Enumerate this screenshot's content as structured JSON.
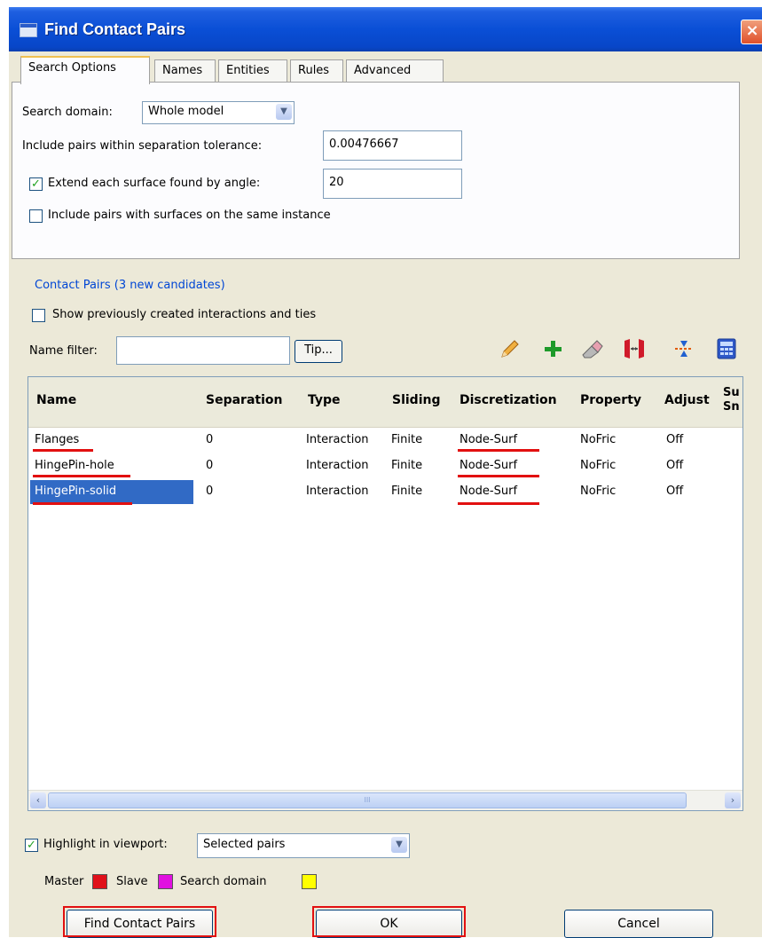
{
  "window": {
    "title": "Find Contact Pairs",
    "close_glyph": "×"
  },
  "tabs": [
    {
      "label": "Search Options",
      "active": true
    },
    {
      "label": "Names",
      "active": false
    },
    {
      "label": "Entities",
      "active": false
    },
    {
      "label": "Rules",
      "active": false
    },
    {
      "label": "Advanced",
      "active": false
    }
  ],
  "search_options": {
    "search_domain_label": "Search domain:",
    "search_domain_value": "Whole model",
    "tolerance_label": "Include pairs within separation tolerance:",
    "tolerance_value": "0.00476667",
    "extend_label": "Extend each surface found by angle:",
    "extend_checked": true,
    "extend_value": "20",
    "same_instance_label": "Include pairs with surfaces on the same instance",
    "same_instance_checked": false
  },
  "contact_pairs": {
    "section_label": "Contact Pairs (3 new candidates)",
    "show_previous_label": "Show previously created interactions and ties",
    "show_previous_checked": false,
    "name_filter_label": "Name filter:",
    "name_filter_value": "",
    "tip_label": "Tip...",
    "toolbar_icons": [
      "edit-pencil-icon",
      "add-plus-icon",
      "eraser-icon",
      "swap-surfaces-icon",
      "adjust-icon",
      "calculator-icon"
    ]
  },
  "table": {
    "columns": [
      "Name",
      "Separation",
      "Type",
      "Sliding",
      "Discretization",
      "Property",
      "Adjust"
    ],
    "overflow_header": [
      "Su",
      "Sn"
    ],
    "rows": [
      {
        "name": "Flanges",
        "separation": "0",
        "type": "Interaction",
        "sliding": "Finite",
        "discretization": "Node-Surf",
        "property": "NoFric",
        "adjust": "Off",
        "selected": false
      },
      {
        "name": "HingePin-hole",
        "separation": "0",
        "type": "Interaction",
        "sliding": "Finite",
        "discretization": "Node-Surf",
        "property": "NoFric",
        "adjust": "Off",
        "selected": false
      },
      {
        "name": "HingePin-solid",
        "separation": "0",
        "type": "Interaction",
        "sliding": "Finite",
        "discretization": "Node-Surf",
        "property": "NoFric",
        "adjust": "Off",
        "selected": true
      }
    ],
    "scroll_left": "‹",
    "scroll_right": "›",
    "scroll_grip": "III"
  },
  "highlight": {
    "label": "Highlight in viewport:",
    "checked": true,
    "value": "Selected pairs",
    "legend": [
      {
        "label": "Master",
        "color": "#e0101a"
      },
      {
        "label": "Slave",
        "color": "#e010e0"
      },
      {
        "label": "Search domain",
        "color": "#ffff00"
      }
    ]
  },
  "buttons": {
    "find": "Find Contact Pairs",
    "ok": "OK",
    "cancel": "Cancel"
  },
  "colors": {
    "title_bar": "#0a4fd6",
    "dialog_bg": "#ece9d8",
    "selection": "#316ac5",
    "annotation_red": "#e21010"
  }
}
